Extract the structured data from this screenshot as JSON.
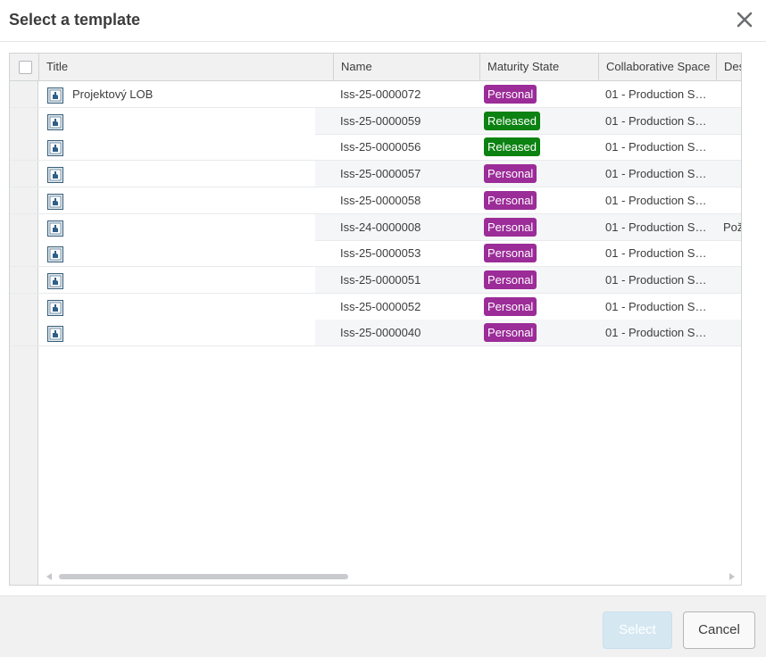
{
  "dialog": {
    "title": "Select a template",
    "close_icon": "close-icon"
  },
  "table": {
    "columns": [
      "Title",
      "Name",
      "Maturity State",
      "Collaborative Space",
      "Des"
    ],
    "rows": [
      {
        "title": "Projektový LOB",
        "name": "Iss-25-0000072",
        "state": "Personal",
        "space": "01 - Production S…",
        "desc": ""
      },
      {
        "title": "",
        "name": "Iss-25-0000059",
        "state": "Released",
        "space": "01 - Production S…",
        "desc": ""
      },
      {
        "title": "",
        "name": "Iss-25-0000056",
        "state": "Released",
        "space": "01 - Production S…",
        "desc": ""
      },
      {
        "title": "",
        "name": "Iss-25-0000057",
        "state": "Personal",
        "space": "01 - Production S…",
        "desc": ""
      },
      {
        "title": "",
        "name": "Iss-25-0000058",
        "state": "Personal",
        "space": "01 - Production S…",
        "desc": ""
      },
      {
        "title": "",
        "name": "Iss-24-0000008",
        "state": "Personal",
        "space": "01 - Production S…",
        "desc": "Pož"
      },
      {
        "title": "",
        "name": "Iss-25-0000053",
        "state": "Personal",
        "space": "01 - Production S…",
        "desc": ""
      },
      {
        "title": "",
        "name": "Iss-25-0000051",
        "state": "Personal",
        "space": "01 - Production S…",
        "desc": ""
      },
      {
        "title": "",
        "name": "Iss-25-0000052",
        "state": "Personal",
        "space": "01 - Production S…",
        "desc": ""
      },
      {
        "title": "",
        "name": "Iss-25-0000040",
        "state": "Personal",
        "space": "01 - Production S…",
        "desc": ""
      }
    ]
  },
  "colors": {
    "personal": "#9b2c98",
    "released": "#0b8211"
  },
  "footer": {
    "select_label": "Select",
    "cancel_label": "Cancel"
  }
}
